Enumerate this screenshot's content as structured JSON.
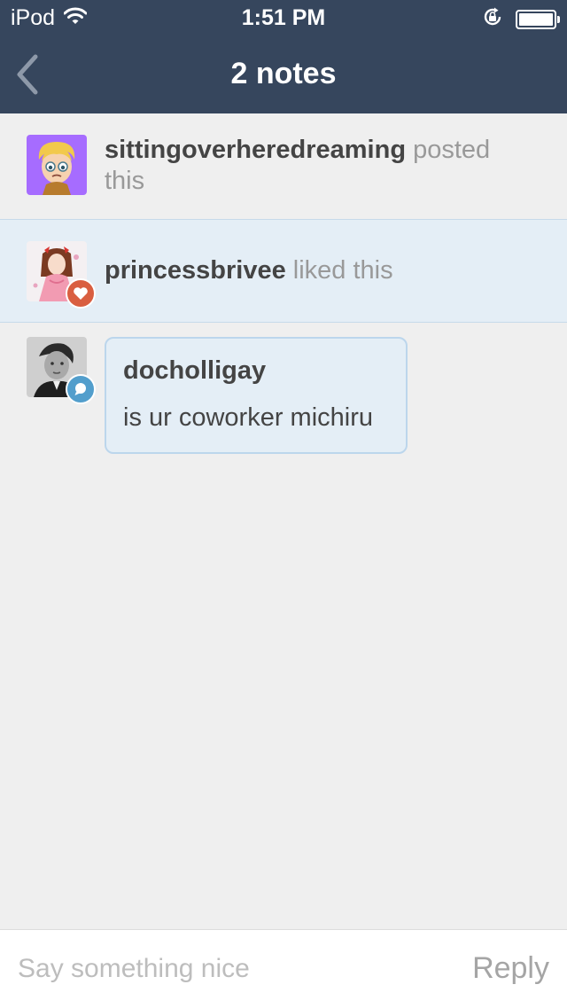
{
  "status_bar": {
    "device": "iPod",
    "time": "1:51 PM",
    "icons": [
      "wifi-icon",
      "rotation-lock-icon",
      "battery-icon"
    ]
  },
  "nav": {
    "title": "2 notes",
    "back_icon": "chevron-left-icon"
  },
  "notes": [
    {
      "type": "posted",
      "username": "sittingoverheredreaming",
      "action": "posted this"
    },
    {
      "type": "liked",
      "username": "princessbrivee",
      "action": "liked this",
      "badge_icon": "heart-icon",
      "badge_color": "#d95e40"
    },
    {
      "type": "reply",
      "username": "docholligay",
      "text": "is ur coworker michiru",
      "badge_icon": "speech-bubble-icon",
      "badge_color": "#529ecc"
    }
  ],
  "reply_bar": {
    "placeholder": "Say something nice",
    "value": "",
    "button_label": "Reply"
  },
  "colors": {
    "nav_background": "#36465d",
    "page_background": "#efefef",
    "highlight_background": "#e4eef6"
  }
}
